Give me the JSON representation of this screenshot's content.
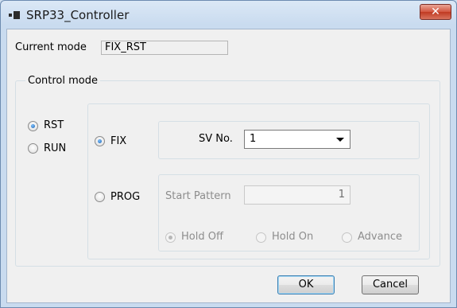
{
  "window": {
    "title": "SRP33_Controller",
    "close_glyph": "✕"
  },
  "current_mode": {
    "label": "Current mode",
    "value": "FIX_RST"
  },
  "control_mode": {
    "caption": "Control mode",
    "run_state": [
      {
        "label": "RST",
        "checked": true
      },
      {
        "label": "RUN",
        "checked": false
      }
    ],
    "fix": {
      "label": "FIX",
      "checked": true,
      "sv_label": "SV No.",
      "sv_value": "1"
    },
    "prog": {
      "label": "PROG",
      "checked": false,
      "start_pattern_label": "Start Pattern",
      "start_pattern_value": "1",
      "hold_options": [
        {
          "label": "Hold Off",
          "checked": true
        },
        {
          "label": "Hold On",
          "checked": false
        },
        {
          "label": "Advance",
          "checked": false
        }
      ]
    }
  },
  "buttons": {
    "ok": "OK",
    "cancel": "Cancel"
  }
}
